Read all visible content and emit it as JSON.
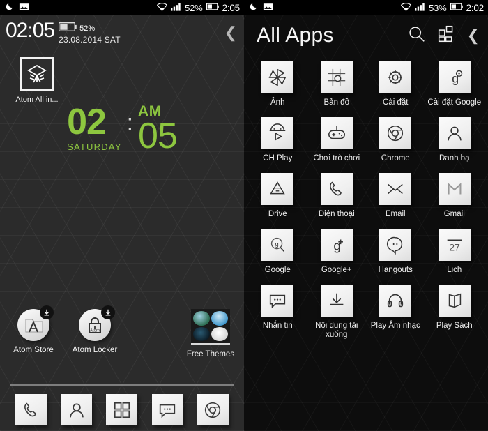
{
  "left_screen": {
    "statusbar": {
      "notif_icons": [
        "crescent-moon-icon",
        "screenshot-image-icon"
      ],
      "wifi_icon": "wifi-icon",
      "signal_icon": "signal-bars-icon",
      "battery_percent": "52%",
      "battery_icon": "battery-icon",
      "time": "2:05"
    },
    "lock_header": {
      "time": "02:05",
      "battery_percent": "52%",
      "date": "23.08.2014  SAT",
      "chevron_icon": "chevron-left-icon"
    },
    "top_app": {
      "icon": "atom-all-in-one-icon",
      "label": "Atom All in..."
    },
    "clock_widget": {
      "hour": "02",
      "colon": ":",
      "minute": "05",
      "ampm": "AM",
      "weekday": "SATURDAY",
      "accent_color": "#8dc63f"
    },
    "shortcuts": [
      {
        "icon": "atom-store-icon",
        "label": "Atom Store",
        "badge": "download-badge-icon"
      },
      {
        "icon": "atom-locker-icon",
        "label": "Atom Locker",
        "badge": "download-badge-icon"
      }
    ],
    "folder": {
      "label": "Free Themes",
      "thumbs": [
        "theme-landscape-thumb",
        "theme-blue-thumb",
        "theme-dark-thumb",
        "theme-typography-thumb"
      ]
    },
    "dock": [
      {
        "icon": "phone-icon",
        "name": "dock-phone"
      },
      {
        "icon": "contacts-person-icon",
        "name": "dock-contacts"
      },
      {
        "icon": "app-drawer-grid-icon",
        "name": "dock-app-drawer"
      },
      {
        "icon": "message-bubble-icon",
        "name": "dock-messages"
      },
      {
        "icon": "chrome-icon",
        "name": "dock-chrome"
      }
    ]
  },
  "right_screen": {
    "statusbar": {
      "notif_icons": [
        "crescent-moon-icon",
        "screenshot-image-icon"
      ],
      "wifi_icon": "wifi-icon",
      "signal_icon": "signal-bars-icon",
      "battery_percent": "53%",
      "battery_icon": "battery-icon",
      "time": "2:02"
    },
    "header": {
      "title": "All Apps",
      "search_icon": "search-icon",
      "layout_icon": "grid-layout-icon",
      "back_icon": "chevron-left-icon"
    },
    "apps": [
      {
        "label": "Ảnh",
        "icon": "photos-pinwheel-icon"
      },
      {
        "label": "Bản đồ",
        "icon": "maps-icon"
      },
      {
        "label": "Cài đặt",
        "icon": "settings-gear-icon"
      },
      {
        "label": "Cài đặt Google",
        "icon": "google-settings-icon"
      },
      {
        "label": "CH Play",
        "icon": "play-store-icon"
      },
      {
        "label": "Chơi trò chơi",
        "icon": "game-controller-icon"
      },
      {
        "label": "Chrome",
        "icon": "chrome-icon"
      },
      {
        "label": "Danh bạ",
        "icon": "contacts-person-icon"
      },
      {
        "label": "Drive",
        "icon": "google-drive-icon"
      },
      {
        "label": "Điện thoại",
        "icon": "phone-icon"
      },
      {
        "label": "Email",
        "icon": "email-envelope-icon"
      },
      {
        "label": "Gmail",
        "icon": "gmail-icon"
      },
      {
        "label": "Google",
        "icon": "google-search-icon"
      },
      {
        "label": "Google+",
        "icon": "google-plus-icon"
      },
      {
        "label": "Hangouts",
        "icon": "hangouts-icon"
      },
      {
        "label": "Lịch",
        "icon": "calendar-icon",
        "badge": "27"
      },
      {
        "label": "Nhắn tin",
        "icon": "message-bubble-icon"
      },
      {
        "label": "Nội dung tải xuống",
        "icon": "downloads-icon"
      },
      {
        "label": "Play Âm nhạc",
        "icon": "play-music-headphones-icon"
      },
      {
        "label": "Play Sách",
        "icon": "play-books-icon"
      }
    ]
  }
}
